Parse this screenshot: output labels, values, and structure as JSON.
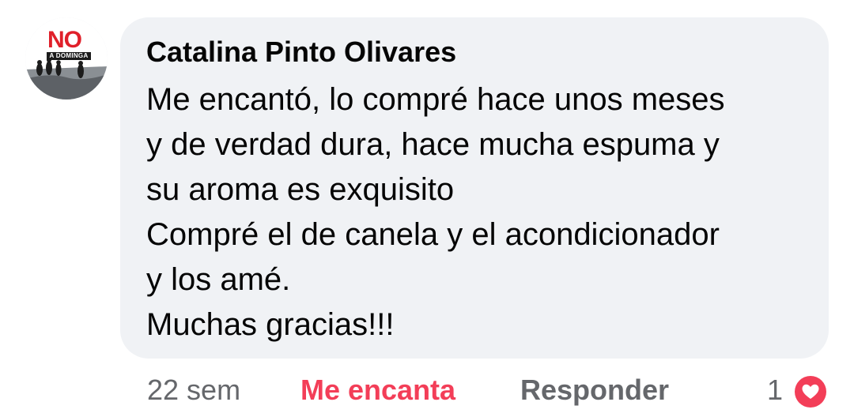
{
  "comment": {
    "avatar": {
      "logo_text": "NO",
      "logo_subtext": "A DOMINGA",
      "icon": "profile-avatar"
    },
    "author": "Catalina Pinto Olivares",
    "lines": [
      "Me encantó, lo compré hace unos meses",
      "y de verdad dura, hace mucha espuma y",
      "su aroma es exquisito",
      "Compré el de canela y el acondicionador",
      "y los amé.",
      "Muchas gracias!!!"
    ]
  },
  "actions": {
    "time": "22 sem",
    "reaction_label": "Me encanta",
    "reply_label": "Responder",
    "reaction_count": "1",
    "reaction_icon": "heart-icon"
  },
  "colors": {
    "bubble_bg": "#f0f2f5",
    "love_red": "#f33e58",
    "muted_text": "#65676b",
    "text": "#050505"
  }
}
